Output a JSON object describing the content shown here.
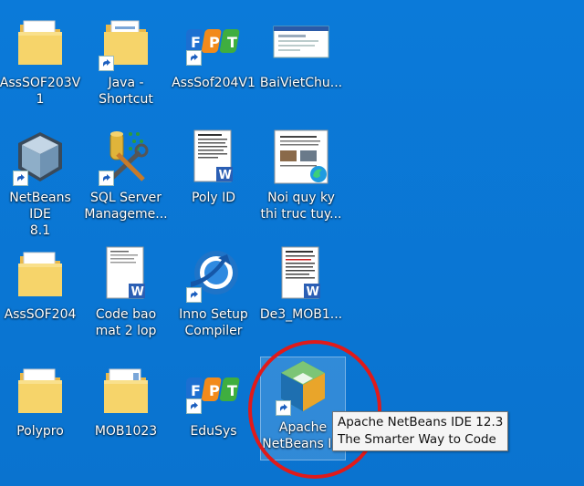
{
  "desktop": {
    "icons": [
      {
        "label": "AssSOF203V1",
        "icon": "folder-icon"
      },
      {
        "label": "Java -\nShortcut",
        "icon": "folder-shortcut-icon"
      },
      {
        "label": "AssSof204V1",
        "icon": "fpt-logo-icon"
      },
      {
        "label": "BaiVietChu...",
        "icon": "screenshot-file-icon"
      },
      {
        "label": "NetBeans IDE\n8.1",
        "icon": "netbeans-cube-icon"
      },
      {
        "label": "SQL Server\nManageme...",
        "icon": "sql-server-tools-icon"
      },
      {
        "label": "Poly ID",
        "icon": "word-document-icon"
      },
      {
        "label": "Noi quy ky\nthi truc tuy...",
        "icon": "edge-pdf-document-icon"
      },
      {
        "label": "AssSOF204",
        "icon": "folder-icon"
      },
      {
        "label": "Code bao\nmat 2 lop",
        "icon": "word-document-icon"
      },
      {
        "label": "Inno Setup\nCompiler",
        "icon": "inno-setup-icon"
      },
      {
        "label": "De3_MOB1...",
        "icon": "word-document-icon"
      },
      {
        "label": "Polypro",
        "icon": "folder-icon"
      },
      {
        "label": "MOB1023",
        "icon": "folder-icon"
      },
      {
        "label": "EduSys",
        "icon": "fpt-logo-icon"
      },
      {
        "label": "Apache\nNetBeans I...",
        "icon": "apache-netbeans-icon"
      }
    ]
  },
  "tooltip": {
    "line1": "Apache NetBeans IDE 12.3",
    "line2": "The Smarter Way to Code"
  },
  "colors": {
    "desktop_bg": "#0a78d7",
    "annotation_circle": "#e01a1a"
  }
}
